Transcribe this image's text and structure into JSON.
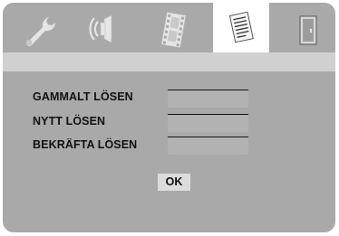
{
  "tabs": [
    {
      "icon": "wrench-icon",
      "active": false
    },
    {
      "icon": "speaker-icon",
      "active": false
    },
    {
      "icon": "film-icon",
      "active": false
    },
    {
      "icon": "document-icon",
      "active": true
    },
    {
      "icon": "exit-door-icon",
      "active": false
    }
  ],
  "form": {
    "old_password_label": "GAMMALT LÖSEN",
    "new_password_label": "NYTT LÖSEN",
    "confirm_password_label": "BEKRÄFTA LÖSEN",
    "old_password_value": "",
    "new_password_value": "",
    "confirm_password_value": ""
  },
  "ok_label": "OK",
  "colors": {
    "screen_bg": "#a9a9a9",
    "header_bar": "#d0d0d0",
    "active_tab": "#ffffff",
    "icon_fill": "#e6e6e6",
    "field_bg": "#b2b2b2",
    "button_bg": "#dcdcdc"
  }
}
